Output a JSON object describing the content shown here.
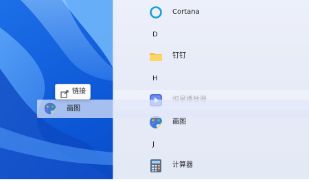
{
  "start_menu": {
    "apps": [
      {
        "label": "Cortana",
        "icon": "cortana-icon"
      },
      {
        "label": "钉钉",
        "icon": "folder-icon"
      },
      {
        "label": "恒星播放器",
        "icon": "media-player-icon"
      },
      {
        "label": "画图",
        "icon": "paint-icon"
      },
      {
        "label": "计算器",
        "icon": "calculator-icon"
      }
    ],
    "letters": [
      "D",
      "H",
      "J"
    ]
  },
  "drag": {
    "label": "画图",
    "icon": "paint-icon"
  },
  "tooltip": {
    "label": "链接",
    "icon": "link-icon"
  },
  "colors": {
    "menu_bg": "#e8ecf8",
    "cortana": "#15a0d8",
    "folder": "#f6c343",
    "player": "#4a6fe0",
    "desktop_blue": "#1057d6"
  }
}
